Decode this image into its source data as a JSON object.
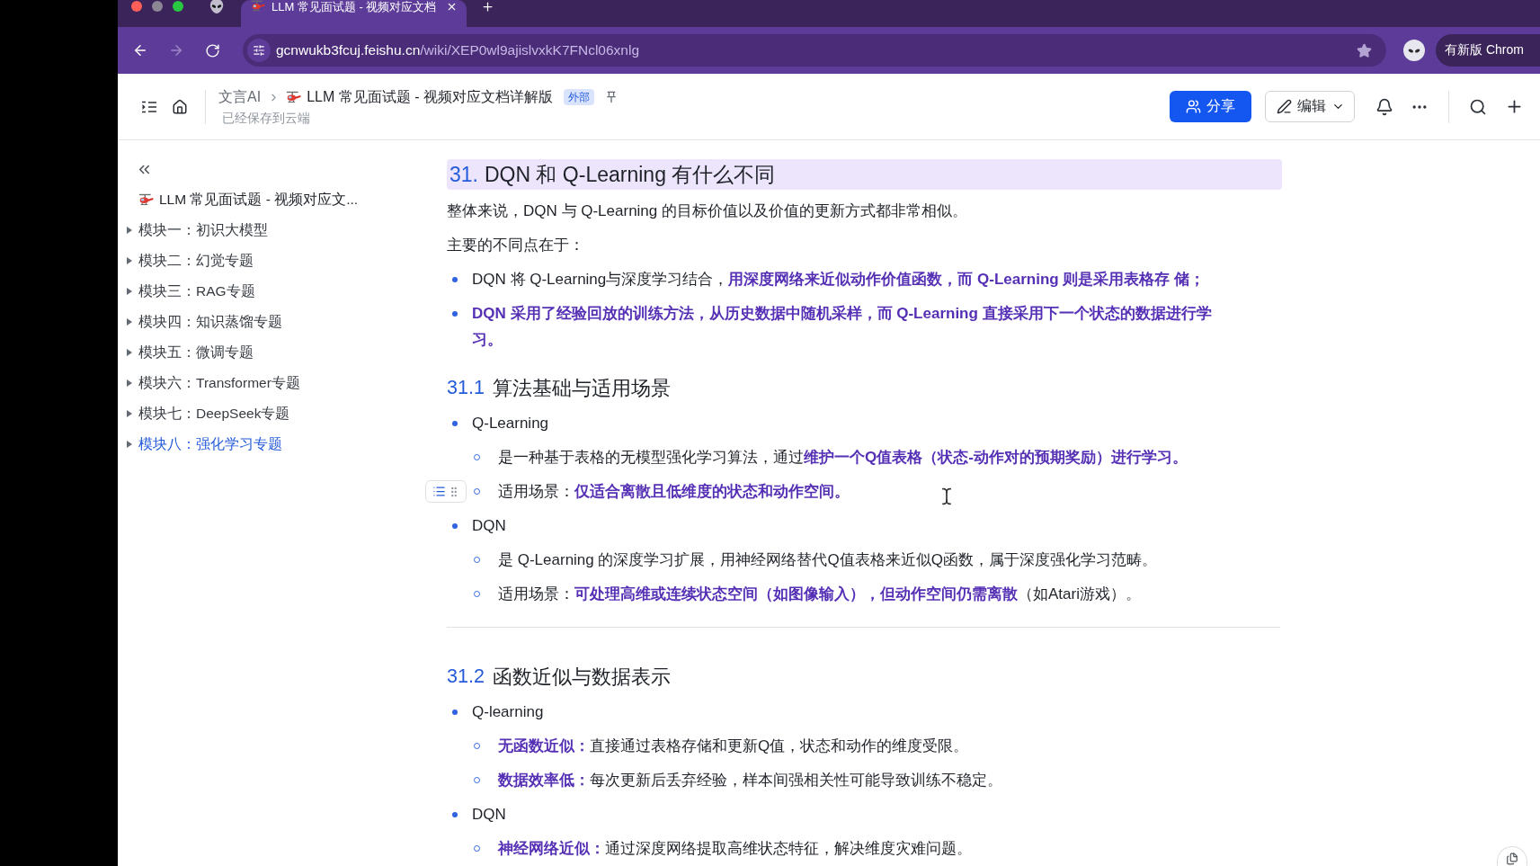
{
  "browser": {
    "tabs": [
      {
        "title": "LLM 常见面试题 - 视频对应文档",
        "selected": true
      }
    ],
    "url": {
      "host": "gcnwukb3fcuj.feishu.cn",
      "path": "/wiki/XEP0wl9ajislvxkK7FNcl06xnlg"
    },
    "update_button": "有新版 Chrom"
  },
  "header": {
    "breadcrumb": [
      {
        "label": "文言AI"
      },
      {
        "label": "LLM 常见面试题 - 视频对应文档详解版"
      }
    ],
    "badge": "外部",
    "save_status": "已经保存到云端",
    "share_button": "分享",
    "edit_button": "编辑"
  },
  "sidebar": {
    "root": "LLM 常见面试题 - 视频对应文...",
    "items": [
      {
        "label": "模块一：初识大模型",
        "selected": false,
        "expanded": false
      },
      {
        "label": "模块二：幻觉专题",
        "selected": false,
        "expanded": false
      },
      {
        "label": "模块三：RAG专题",
        "selected": false,
        "expanded": false
      },
      {
        "label": "模块四：知识蒸馏专题",
        "selected": false,
        "expanded": false
      },
      {
        "label": "模块五：微调专题",
        "selected": false,
        "expanded": false
      },
      {
        "label": "模块六：Transformer专题",
        "selected": false,
        "expanded": false
      },
      {
        "label": "模块七：DeepSeek专题",
        "selected": false,
        "expanded": false
      },
      {
        "label": "模块八：强化学习专题",
        "selected": true,
        "expanded": false
      }
    ]
  },
  "document": {
    "blocks": [
      {
        "kind": "heading1",
        "number": "31.",
        "text": "DQN 和 Q-Learning 有什么不同"
      },
      {
        "kind": "paragraph",
        "text": "整体来说，DQN 与 Q-Learning 的目标价值以及价值的更新方式都非常相似。"
      },
      {
        "kind": "paragraph",
        "text": "主要的不同点在于："
      },
      {
        "kind": "bullet",
        "emphasized": false,
        "text": "DQN 将 Q-Learning与深度学习结合，**用深度网络来近似动作价值函数，而 Q-Learning 则是采用表格存 储；**"
      },
      {
        "kind": "bullet",
        "emphasized": true,
        "text": "DQN 采用了经验回放的训练方法，从历史数据中随机采样，而 Q-Learning 直接采用下一个状态的数据进行学习。"
      },
      {
        "kind": "heading2",
        "number": "31.1",
        "text": "算法基础与适用场景"
      },
      {
        "kind": "bullet",
        "emphasized": false,
        "text": "Q-Learning",
        "children": [
          {
            "text": "是一种基于表格的无模型强化学习算法，通过**维护一个Q值表格（状态-动作对的预期奖励）进行学习。**",
            "hovered": false
          },
          {
            "text": "适用场景：**仅适合离散且低维度的状态和动作空间。**",
            "hovered": true
          }
        ]
      },
      {
        "kind": "bullet",
        "emphasized": false,
        "text": "DQN",
        "children": [
          {
            "text": "是 Q-Learning 的深度学习扩展，用神经网络替代Q值表格来近似Q函数，属于深度强化学习范畴。",
            "hovered": false
          },
          {
            "text": "适用场景：**可处理高维或连续状态空间（如图像输入），但动作空间仍需离散**（如Atari游戏）。",
            "hovered": false
          }
        ]
      },
      {
        "kind": "divider"
      },
      {
        "kind": "heading2",
        "number": "31.2",
        "text": "函数近似与数据表示"
      },
      {
        "kind": "bullet",
        "emphasized": false,
        "text": "Q-learning",
        "children": [
          {
            "text": "**无函数近似：**直接通过表格存储和更新Q值，状态和动作的维度受限。",
            "hovered": false
          },
          {
            "text": "**数据效率低：**每次更新后丢弃经验，样本间强相关性可能导致训练不稳定。",
            "hovered": false
          }
        ]
      },
      {
        "kind": "bullet",
        "emphasized": false,
        "text": "DQN",
        "children": [
          {
            "text": "**神经网络近似：**通过深度网络提取高维状态特征，解决维度灾难问题。",
            "hovered": false
          }
        ]
      }
    ]
  }
}
